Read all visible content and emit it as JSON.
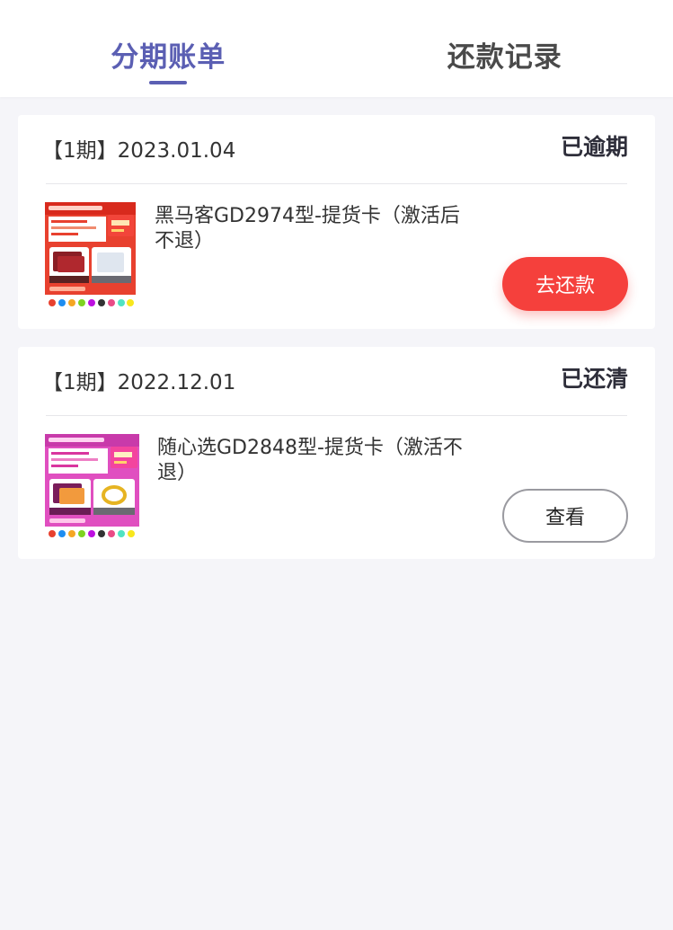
{
  "tabs": [
    {
      "label": "分期账单",
      "active": true
    },
    {
      "label": "还款记录",
      "active": false
    }
  ],
  "bills": [
    {
      "period": "【1期】2023.01.04",
      "status": "已逾期",
      "product_name": "黑马客GD2974型-提货卡（激活后不退）",
      "action_label": "去还款",
      "thumbnail": "product-card-image-red"
    },
    {
      "period": "【1期】2022.12.01",
      "status": "已还清",
      "product_name": "随心选GD2848型-提货卡（激活不退）",
      "action_label": "查看",
      "thumbnail": "product-card-image-pink"
    }
  ],
  "colors": {
    "accent": "#5b5fb3",
    "pay_button": "#f5403c",
    "background": "#f5f5f9"
  }
}
